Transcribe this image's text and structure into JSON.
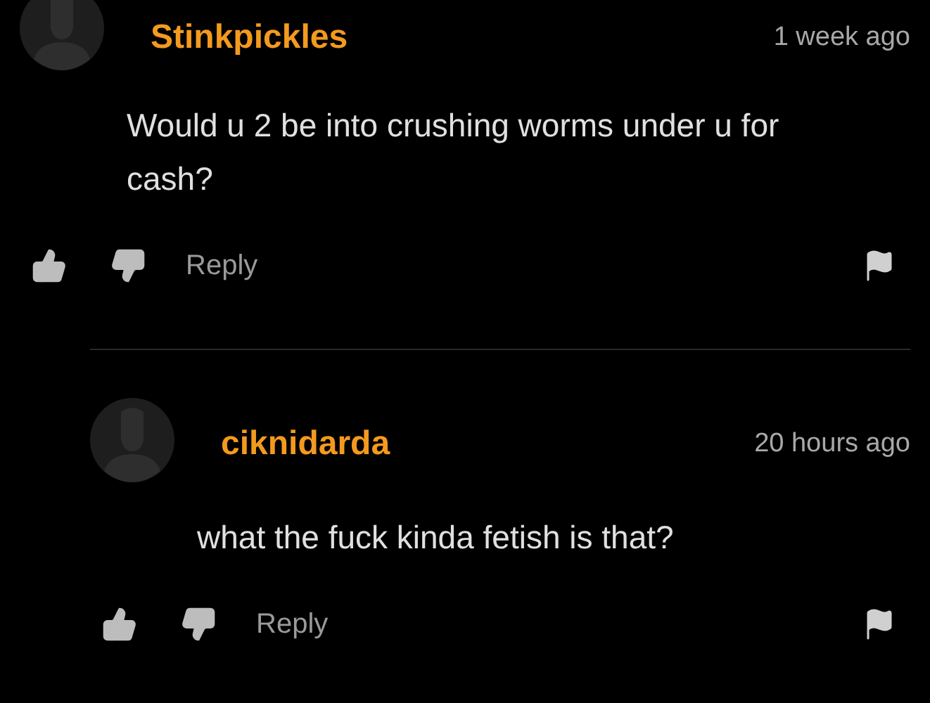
{
  "comments": [
    {
      "username": "Stinkpickles",
      "time": "1 week ago",
      "text": "Would u 2 be into crushing worms under u for cash?",
      "reply_label": "Reply",
      "children": [
        {
          "username": "ciknidarda",
          "time": "20 hours ago",
          "text": "what the fuck kinda fetish is that?",
          "reply_label": "Reply"
        }
      ]
    }
  ]
}
